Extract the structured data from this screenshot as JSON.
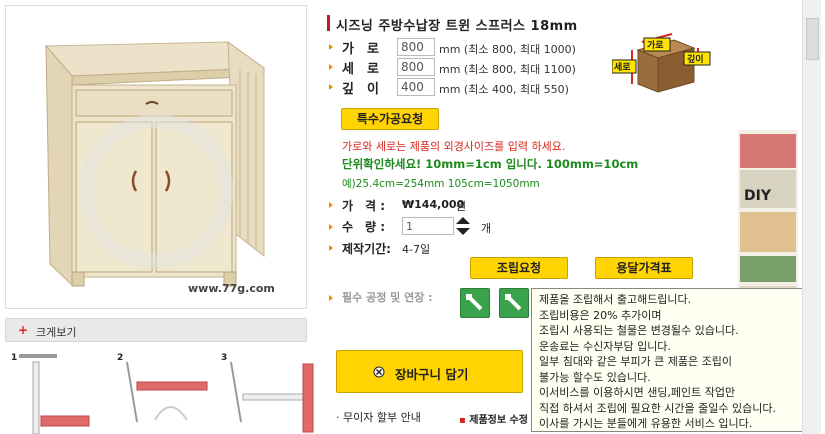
{
  "product": {
    "title": "시즈닝 주방수납장 트윈 스프러스 18mm",
    "watermark": "www.77g.com",
    "zoom_label": "크게보기",
    "zoom_plus": "+"
  },
  "dimensions": [
    {
      "label": "가　로",
      "value": "800",
      "note": "mm (최소 800, 최대 1000)"
    },
    {
      "label": "세　로",
      "value": "800",
      "note": "mm (최소 800, 최대 1100)"
    },
    {
      "label": "깊　이",
      "value": "400",
      "note": "mm (최소 400, 최대 550)"
    }
  ],
  "box_labels": {
    "width": "가로",
    "height": "세로",
    "depth": "깊이"
  },
  "special_request_button": "특수가공요청",
  "guide": {
    "red": "가로와 세로는 제품의 외경사이즈를 입력 하세요.",
    "green": "단위확인하세요! 10mm=1cm 입니다. 100mm=10cm",
    "example": "예)25.4cm=254mm 105cm=1050mm"
  },
  "info": {
    "price_label": "가　격 :",
    "price_value": "₩144,000",
    "price_unit": "원",
    "qty_label": "수　량 :",
    "qty_value": "1",
    "qty_unit": "개",
    "period_label": "제작기간:",
    "period_value": "4-7일"
  },
  "buttons": {
    "assembly": "조립요청",
    "shipping": "용달가격표",
    "cart": "장바구니 담기"
  },
  "options_label": "필수 공정 및 연장 :",
  "installment": "무이자 할부 안내",
  "product_info_link": "제품정보 수정",
  "tooltip_lines": [
    "제품을 조립해서 출고해드립니다.",
    "조립비용은 20% 추가이며",
    "조립시 사용되는 철물은 변경될수 있습니다.",
    "운송료는 수신자부담 입니다.",
    "일부 침대와 같은 부피가 큰 제품은 조립이",
    "불가능 할수도 있습니다.",
    "이서비스를 이용하시면 샌딩,페인트 작업만",
    "직접 하셔서 조립에 필요한 시간을 줄일수 있습니다.",
    "이사를 가시는 분들에게 유용한 서비스 입니다."
  ],
  "steps": [
    "1",
    "2",
    "3"
  ],
  "side_text": "DIY",
  "colors": {
    "accent_red": "#d9261c",
    "yellow": "#ffd400",
    "green": "#3aa24b",
    "guide_green": "#1d8a1d"
  }
}
